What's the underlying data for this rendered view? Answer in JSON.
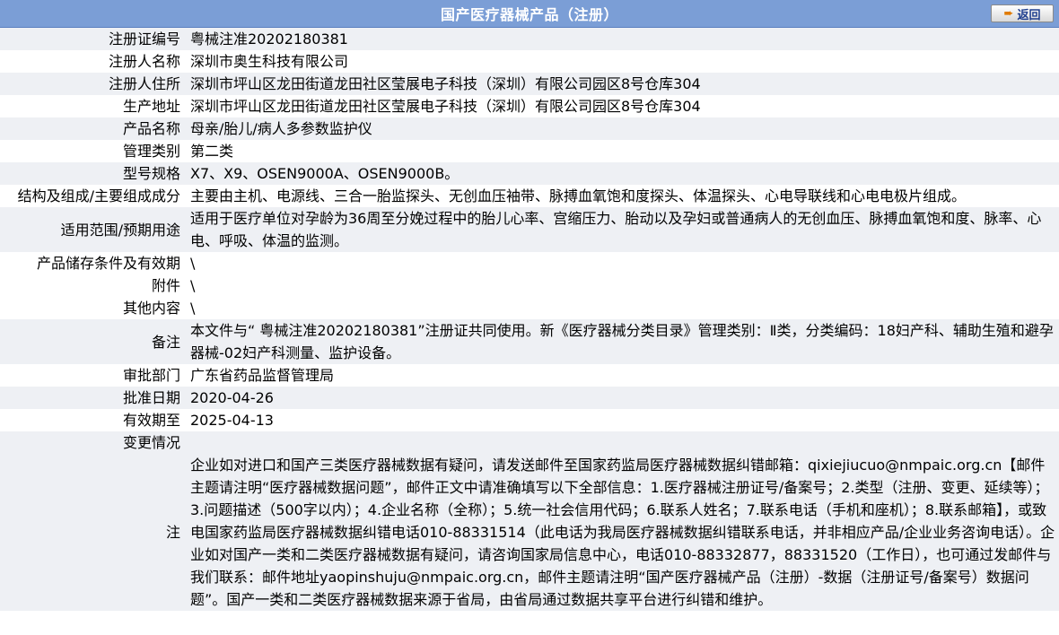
{
  "header": {
    "title": "国产医疗器械产品（注册）",
    "back_label": "返回"
  },
  "rows": [
    {
      "label": "注册证编号",
      "value": "粤械注准20202180381"
    },
    {
      "label": "注册人名称",
      "value": "深圳市奥生科技有限公司"
    },
    {
      "label": "注册人住所",
      "value": "深圳市坪山区龙田街道龙田社区莹展电子科技（深圳）有限公司园区8号仓库304"
    },
    {
      "label": "生产地址",
      "value": "深圳市坪山区龙田街道龙田社区莹展电子科技（深圳）有限公司园区8号仓库304"
    },
    {
      "label": "产品名称",
      "value": "母亲/胎儿/病人多参数监护仪"
    },
    {
      "label": "管理类别",
      "value": "第二类"
    },
    {
      "label": "型号规格",
      "value": "X7、X9、OSEN9000A、OSEN9000B。"
    },
    {
      "label": "结构及组成/主要组成成分",
      "value": "主要由主机、电源线、三合一胎监探头、无创血压袖带、脉搏血氧饱和度探头、体温探头、心电导联线和心电电极片组成。"
    },
    {
      "label": "适用范围/预期用途",
      "value": "适用于医疗单位对孕龄为36周至分娩过程中的胎儿心率、宫缩压力、胎动以及孕妇或普通病人的无创血压、脉搏血氧饱和度、脉率、心电、呼吸、体温的监测。"
    },
    {
      "label": "产品储存条件及有效期",
      "value": "\\"
    },
    {
      "label": "附件",
      "value": "\\"
    },
    {
      "label": "其他内容",
      "value": "\\"
    },
    {
      "label": "备注",
      "value": "本文件与“ 粤械注准20202180381”注册证共同使用。新《医疗器械分类目录》管理类别：Ⅱ类，分类编码：18妇产科、辅助生殖和避孕器械-02妇产科测量、监护设备。"
    },
    {
      "label": "审批部门",
      "value": "广东省药品监督管理局"
    },
    {
      "label": "批准日期",
      "value": "2020-04-26"
    },
    {
      "label": "有效期至",
      "value": "2025-04-13"
    },
    {
      "label": "变更情况",
      "value": ""
    }
  ],
  "note": {
    "label": "注",
    "text": "企业如对进口和国产三类医疗器械数据有疑问，请发送邮件至国家药监局医疗器械数据纠错邮箱：qixiejiucuo@nmpaic.org.cn【邮件主题请注明“医疗器械数据问题”，邮件正文中请准确填写以下全部信息：1.医疗器械注册证号/备案号；2.类型（注册、变更、延续等）；3.问题描述（500字以内）；4.企业名称（全称）；5.统一社会信用代码；6.联系人姓名；7.联系电话（手机和座机）；8.联系邮箱】，或致电国家药监局医疗器械数据纠错电话010-88331514（此电话为我局医疗器械数据纠错联系电话，并非相应产品/企业业务咨询电话）。企业如对国产一类和二类医疗器械数据有疑问，请咨询国家局信息中心，电话010-88332877，88331520（工作日），也可通过发邮件与我们联系：邮件地址yaopinshuju@nmpaic.org.cn，邮件主题请注明“国产医疗器械产品（注册）-数据（注册证号/备案号）数据问题”。国产一类和二类医疗器械数据来源于省局，由省局通过数据共享平台进行纠错和维护。"
  }
}
